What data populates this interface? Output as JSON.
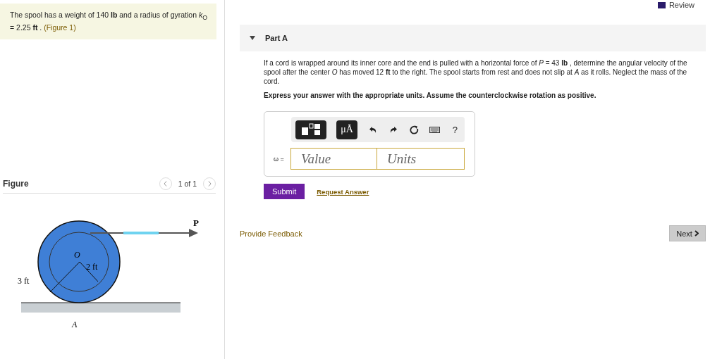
{
  "problem": {
    "text": "The spool has a weight of 140 **lb** and a radius of gyration *k*$_{O}$ = 2.25 **ft** .",
    "figure_link": "(Figure 1)"
  },
  "figure": {
    "title": "Figure",
    "pager": "1 of 1",
    "labels": {
      "force": "P",
      "center": "O",
      "inner_radius": "2 ft",
      "outer_radius": "3 ft",
      "contact": "A"
    }
  },
  "review": "Review",
  "part": {
    "title": "Part A",
    "expanded": true,
    "question": "If a cord is wrapped around its inner core and the end is pulled with a horizontal force of *P* = 43 **lb** , determine the angular velocity of the spool after the center *O* has moved 12 **ft** to the right. The spool starts from rest and does not slip at *A* as it rolls. Neglect the mass of the cord.",
    "instruction": "Express your answer with the appropriate units. Assume the counterclockwise rotation as positive.",
    "toolbar": [
      {
        "kind": "template"
      },
      {
        "kind": "text",
        "label": "μÅ"
      },
      {
        "kind": "undo"
      },
      {
        "kind": "redo"
      },
      {
        "kind": "reset"
      },
      {
        "kind": "keyboard"
      },
      {
        "kind": "help",
        "label": "?"
      }
    ],
    "answer": {
      "symbol": "ω =",
      "value_placeholder": "Value",
      "units_placeholder": "Units"
    },
    "submit": "Submit",
    "request": "Request Answer"
  },
  "feedback": "Provide Feedback",
  "next": "Next"
}
